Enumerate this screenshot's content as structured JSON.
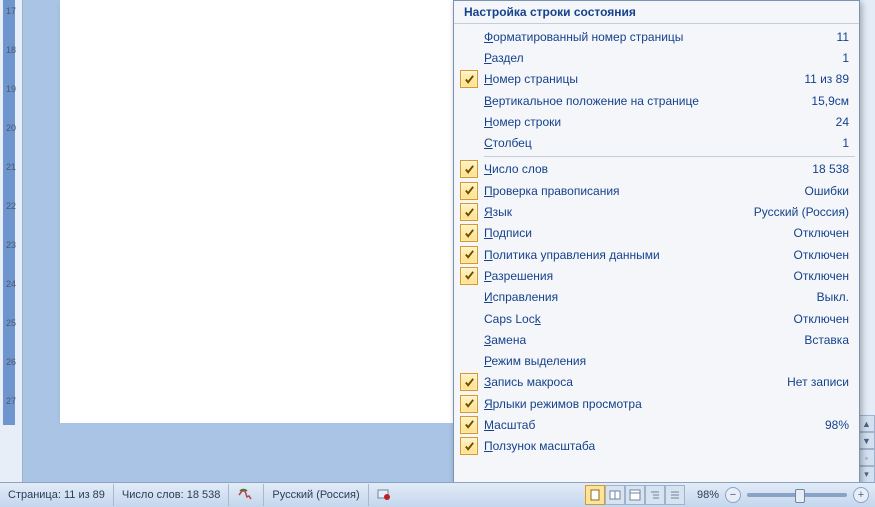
{
  "menu": {
    "title": "Настройка строки состояния",
    "items": [
      {
        "checked": false,
        "label": "Форматированный номер страницы",
        "ul": 0,
        "value": "11"
      },
      {
        "checked": false,
        "label": "Раздел",
        "ul": 0,
        "value": "1"
      },
      {
        "checked": true,
        "label": "Номер страницы",
        "ul": 0,
        "value": "11 из 89"
      },
      {
        "checked": false,
        "label": "Вертикальное положение на странице",
        "ul": 0,
        "value": "15,9см"
      },
      {
        "checked": false,
        "label": "Номер строки",
        "ul": 0,
        "value": "24"
      },
      {
        "checked": false,
        "label": "Столбец",
        "ul": 0,
        "value": "1"
      },
      {
        "sep": true
      },
      {
        "checked": true,
        "label": "Число слов",
        "ul": 0,
        "value": "18 538"
      },
      {
        "checked": true,
        "label": "Проверка правописания",
        "ul": 0,
        "value": "Ошибки"
      },
      {
        "checked": true,
        "label": "Язык",
        "ul": 0,
        "value": "Русский (Россия)"
      },
      {
        "checked": true,
        "label": "Подписи",
        "ul": 0,
        "value": "Отключен"
      },
      {
        "checked": true,
        "label": "Политика управления данными",
        "ul": 0,
        "value": "Отключен"
      },
      {
        "checked": true,
        "label": "Разрешения",
        "ul": 0,
        "value": "Отключен"
      },
      {
        "checked": false,
        "label": "Исправления",
        "ul": 0,
        "value": "Выкл."
      },
      {
        "checked": false,
        "label": "Caps Lock",
        "ul": 8,
        "value": "Отключен"
      },
      {
        "checked": false,
        "label": "Замена",
        "ul": 0,
        "value": "Вставка"
      },
      {
        "checked": false,
        "label": "Режим выделения",
        "ul": 0,
        "value": ""
      },
      {
        "checked": true,
        "label": "Запись макроса",
        "ul": 0,
        "value": "Нет записи"
      },
      {
        "checked": true,
        "label": "Ярлыки режимов просмотра",
        "ul": 0,
        "value": ""
      },
      {
        "checked": true,
        "label": "Масштаб",
        "ul": 0,
        "value": "98%"
      },
      {
        "checked": true,
        "label": "Ползунок масштаба",
        "ul": 0,
        "value": ""
      }
    ]
  },
  "statusbar": {
    "page": "Страница: 11 из 89",
    "words": "Число слов: 18 538",
    "language": "Русский (Россия)",
    "zoom": "98%"
  },
  "ruler": [
    "17",
    "18",
    "19",
    "20",
    "21",
    "22",
    "23",
    "24",
    "25",
    "26",
    "27"
  ]
}
